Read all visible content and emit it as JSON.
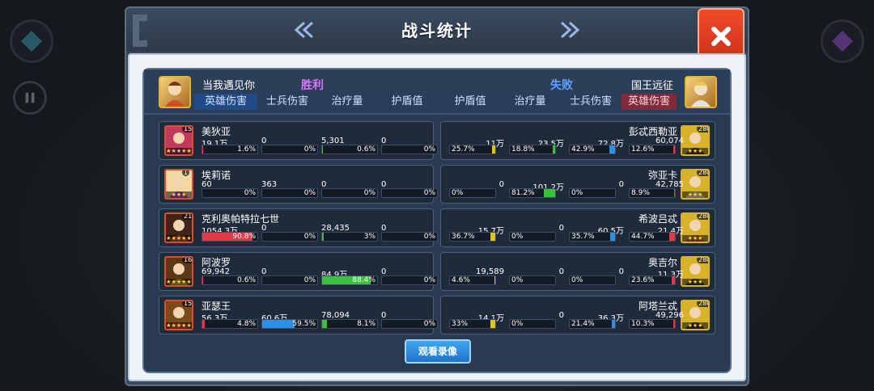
{
  "window": {
    "title": "战斗统计"
  },
  "left_team": {
    "name": "当我遇见你",
    "result": "胜利"
  },
  "right_team": {
    "name": "国王远征",
    "result": "失败"
  },
  "left_tabs": [
    "英雄伤害",
    "士兵伤害",
    "治疗量",
    "护盾值"
  ],
  "right_tabs": [
    "护盾值",
    "治疗量",
    "士兵伤害",
    "英雄伤害"
  ],
  "colors": {
    "hero_damage": "#e03a4a",
    "soldier_damage": "#2e8fe6",
    "healing": "#38c23a",
    "shield": "#e2c21e"
  },
  "left_heroes": [
    {
      "name": "美狄亚",
      "level": "159",
      "stars": "★★★★★",
      "stats": [
        {
          "value": "19.1万",
          "pct": "1.6%",
          "p": 1.6
        },
        {
          "value": "0",
          "pct": "0%",
          "p": 0
        },
        {
          "value": "5,301",
          "pct": "0.6%",
          "p": 0.6
        },
        {
          "value": "0",
          "pct": "0%",
          "p": 0
        }
      ]
    },
    {
      "name": "埃莉诺",
      "level": "1",
      "stars": "★★★",
      "stats": [
        {
          "value": "60",
          "pct": "0%",
          "p": 0
        },
        {
          "value": "363",
          "pct": "0%",
          "p": 0
        },
        {
          "value": "0",
          "pct": "0%",
          "p": 0
        },
        {
          "value": "0",
          "pct": "0%",
          "p": 0
        }
      ]
    },
    {
      "name": "克利奥帕特拉七世",
      "level": "219",
      "stars": "★★★★★",
      "stats": [
        {
          "value": "1054.3万",
          "pct": "90.8%",
          "p": 90.8
        },
        {
          "value": "0",
          "pct": "0%",
          "p": 0
        },
        {
          "value": "28,435",
          "pct": "3%",
          "p": 3
        },
        {
          "value": "0",
          "pct": "0%",
          "p": 0
        }
      ]
    },
    {
      "name": "阿波罗",
      "level": "160",
      "stars": "★★★★★",
      "stats": [
        {
          "value": "69,942",
          "pct": "0.6%",
          "p": 0.6
        },
        {
          "value": "0",
          "pct": "0%",
          "p": 0
        },
        {
          "value": "84.9万",
          "pct": "88.4%",
          "p": 88.4
        },
        {
          "value": "0",
          "pct": "0%",
          "p": 0
        }
      ]
    },
    {
      "name": "亚瑟王",
      "level": "159",
      "stars": "★★★★★",
      "stats": [
        {
          "value": "56.3万",
          "pct": "4.8%",
          "p": 4.8
        },
        {
          "value": "60.6万",
          "pct": "59.5%",
          "p": 59.5
        },
        {
          "value": "78,094",
          "pct": "8.1%",
          "p": 8.1
        },
        {
          "value": "0",
          "pct": "0%",
          "p": 0
        }
      ]
    }
  ],
  "right_heroes": [
    {
      "name": "彭忒西勒亚",
      "level": "280",
      "stars": "★★★",
      "stats": [
        {
          "value": "11万",
          "pct": "25.7%",
          "p": 25.7
        },
        {
          "value": "23.5万",
          "pct": "18.8%",
          "p": 18.8
        },
        {
          "value": "72.8万",
          "pct": "42.9%",
          "p": 42.9
        },
        {
          "value": "60,074",
          "pct": "12.6%",
          "p": 12.6
        }
      ]
    },
    {
      "name": "弥亚卡",
      "level": "280",
      "stars": "★★★",
      "stats": [
        {
          "value": "0",
          "pct": "0%",
          "p": 0
        },
        {
          "value": "101.2万",
          "pct": "81.2%",
          "p": 81.2
        },
        {
          "value": "0",
          "pct": "0%",
          "p": 0
        },
        {
          "value": "42,785",
          "pct": "8.9%",
          "p": 8.9
        }
      ]
    },
    {
      "name": "希波吕忒",
      "level": "280",
      "stars": "★★★",
      "stats": [
        {
          "value": "15.7万",
          "pct": "36.7%",
          "p": 36.7
        },
        {
          "value": "0",
          "pct": "0%",
          "p": 0
        },
        {
          "value": "60.5万",
          "pct": "35.7%",
          "p": 35.7
        },
        {
          "value": "21.4万",
          "pct": "44.7%",
          "p": 44.7
        }
      ]
    },
    {
      "name": "奥吉尔",
      "level": "280",
      "stars": "★★★",
      "stats": [
        {
          "value": "19,589",
          "pct": "4.6%",
          "p": 4.6
        },
        {
          "value": "0",
          "pct": "0%",
          "p": 0
        },
        {
          "value": "0",
          "pct": "0%",
          "p": 0
        },
        {
          "value": "11.3万",
          "pct": "23.6%",
          "p": 23.6
        }
      ]
    },
    {
      "name": "阿塔兰忒",
      "level": "280",
      "stars": "★★★",
      "stats": [
        {
          "value": "14.1万",
          "pct": "33%",
          "p": 33
        },
        {
          "value": "0",
          "pct": "0%",
          "p": 0
        },
        {
          "value": "36.3万",
          "pct": "21.4%",
          "p": 21.4
        },
        {
          "value": "49,296",
          "pct": "10.3%",
          "p": 10.3
        }
      ]
    }
  ],
  "buttons": {
    "watch_replay": "观看录像"
  }
}
